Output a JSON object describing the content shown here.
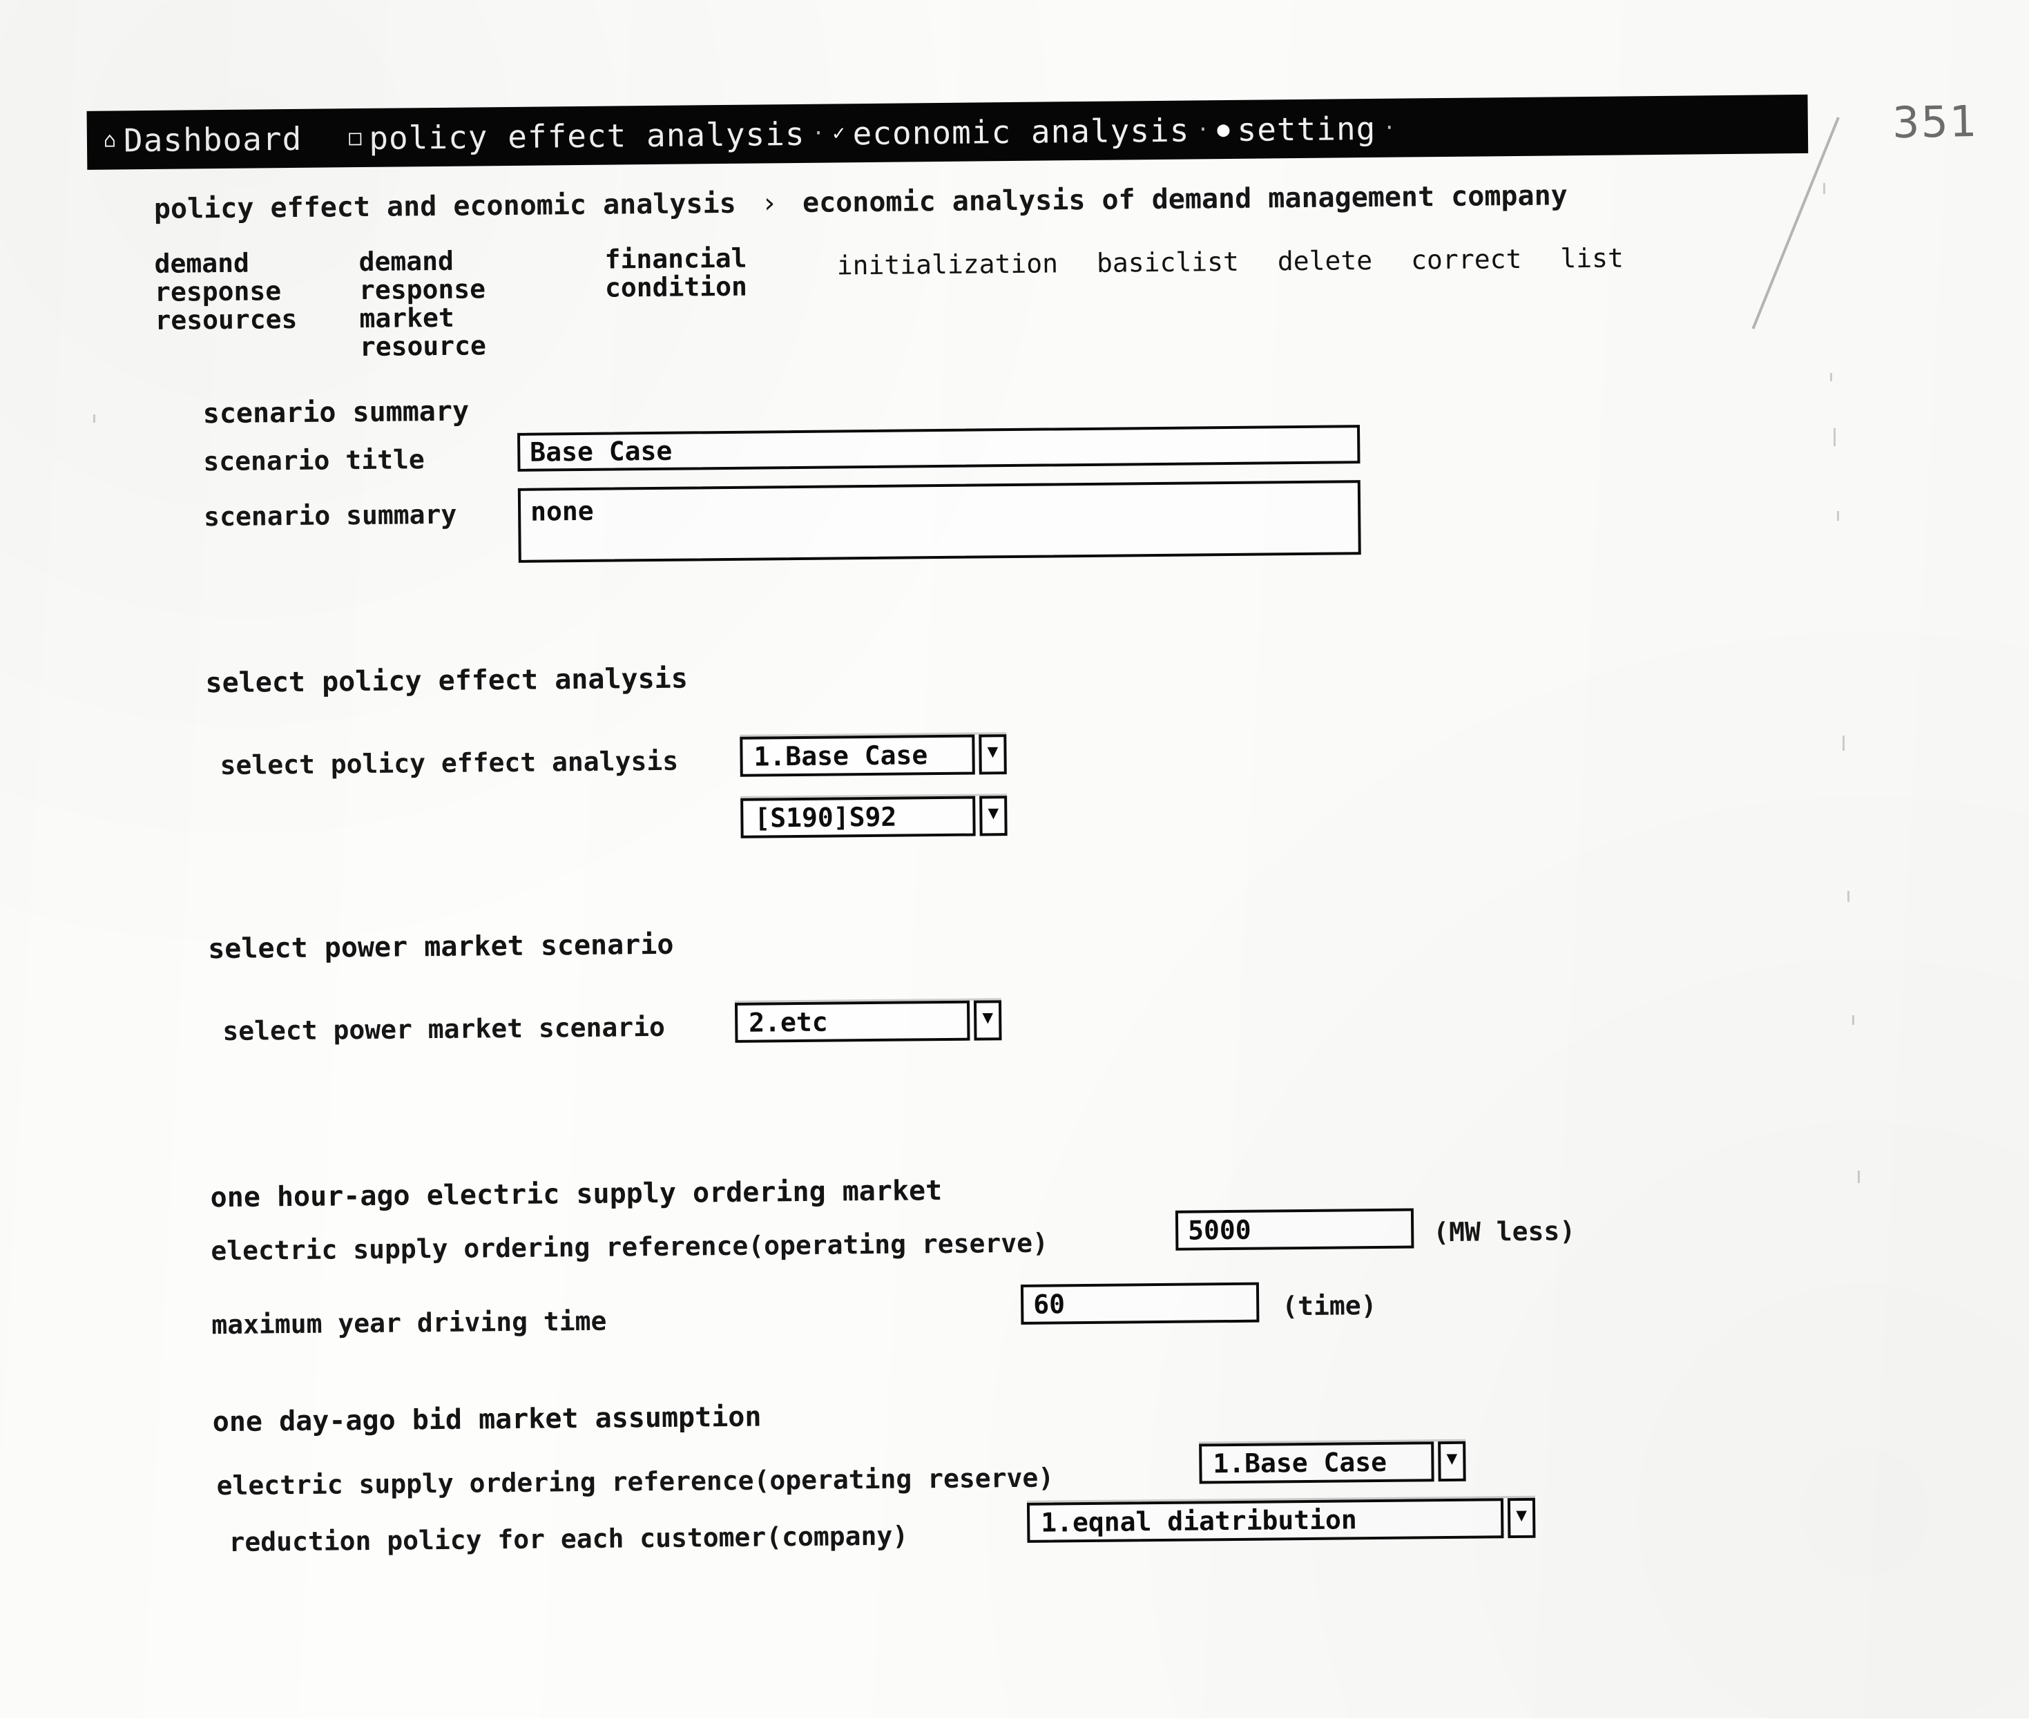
{
  "page": {
    "page_number": "351"
  },
  "navbar": {
    "items": [
      {
        "icon": "home-icon",
        "glyph": "⌂",
        "label": "Dashboard"
      },
      {
        "icon": "document-icon",
        "glyph": "□",
        "label": "policy effect analysis"
      },
      {
        "icon": "chart-icon",
        "glyph": "✓",
        "label": "economic analysis"
      },
      {
        "icon": "gear-icon",
        "glyph": "●",
        "label": "setting"
      }
    ]
  },
  "breadcrumb": {
    "parent": "policy effect and economic analysis",
    "separator": "›",
    "current": "economic analysis of demand management company"
  },
  "tabstrip": {
    "tabs": [
      "demand response resources",
      "demand response market resource",
      "financial condition",
      "initialization",
      "basiclist",
      "delete",
      "correct",
      "list"
    ]
  },
  "scenario_summary": {
    "section_title": "scenario summary",
    "title_label": "scenario title",
    "title_value": "Base Case",
    "summary_label": "scenario summary",
    "summary_value": "none"
  },
  "policy_effect": {
    "section_title": "select policy effect analysis",
    "field_label": "select policy effect analysis",
    "value_1": "1.Base Case",
    "value_2": "[S190]S92"
  },
  "power_market": {
    "section_title": "select power market scenario",
    "field_label": "select power market scenario",
    "value": "2.etc"
  },
  "hour_ago_market": {
    "section_title": "one hour-ago electric supply ordering market",
    "rows": [
      {
        "label": "electric supply ordering reference(operating reserve)",
        "value": "5000",
        "unit": "(MW less)"
      },
      {
        "label": "maximum year driving time",
        "value": "60",
        "unit": "(time)"
      }
    ]
  },
  "day_ago_market": {
    "section_title": "one day-ago bid market assumption",
    "rows": [
      {
        "label": "electric supply ordering reference(operating reserve)",
        "value": "1.Base Case"
      },
      {
        "label": "reduction policy for each customer(company)",
        "value": "1.eqnal diatribution"
      }
    ]
  },
  "colors": {
    "navbar_background": "#060606",
    "navbar_text": "#ffffff",
    "paper": "#fdfdfc",
    "ink": "#111111",
    "page_number_ink": "#6e6e6e"
  }
}
